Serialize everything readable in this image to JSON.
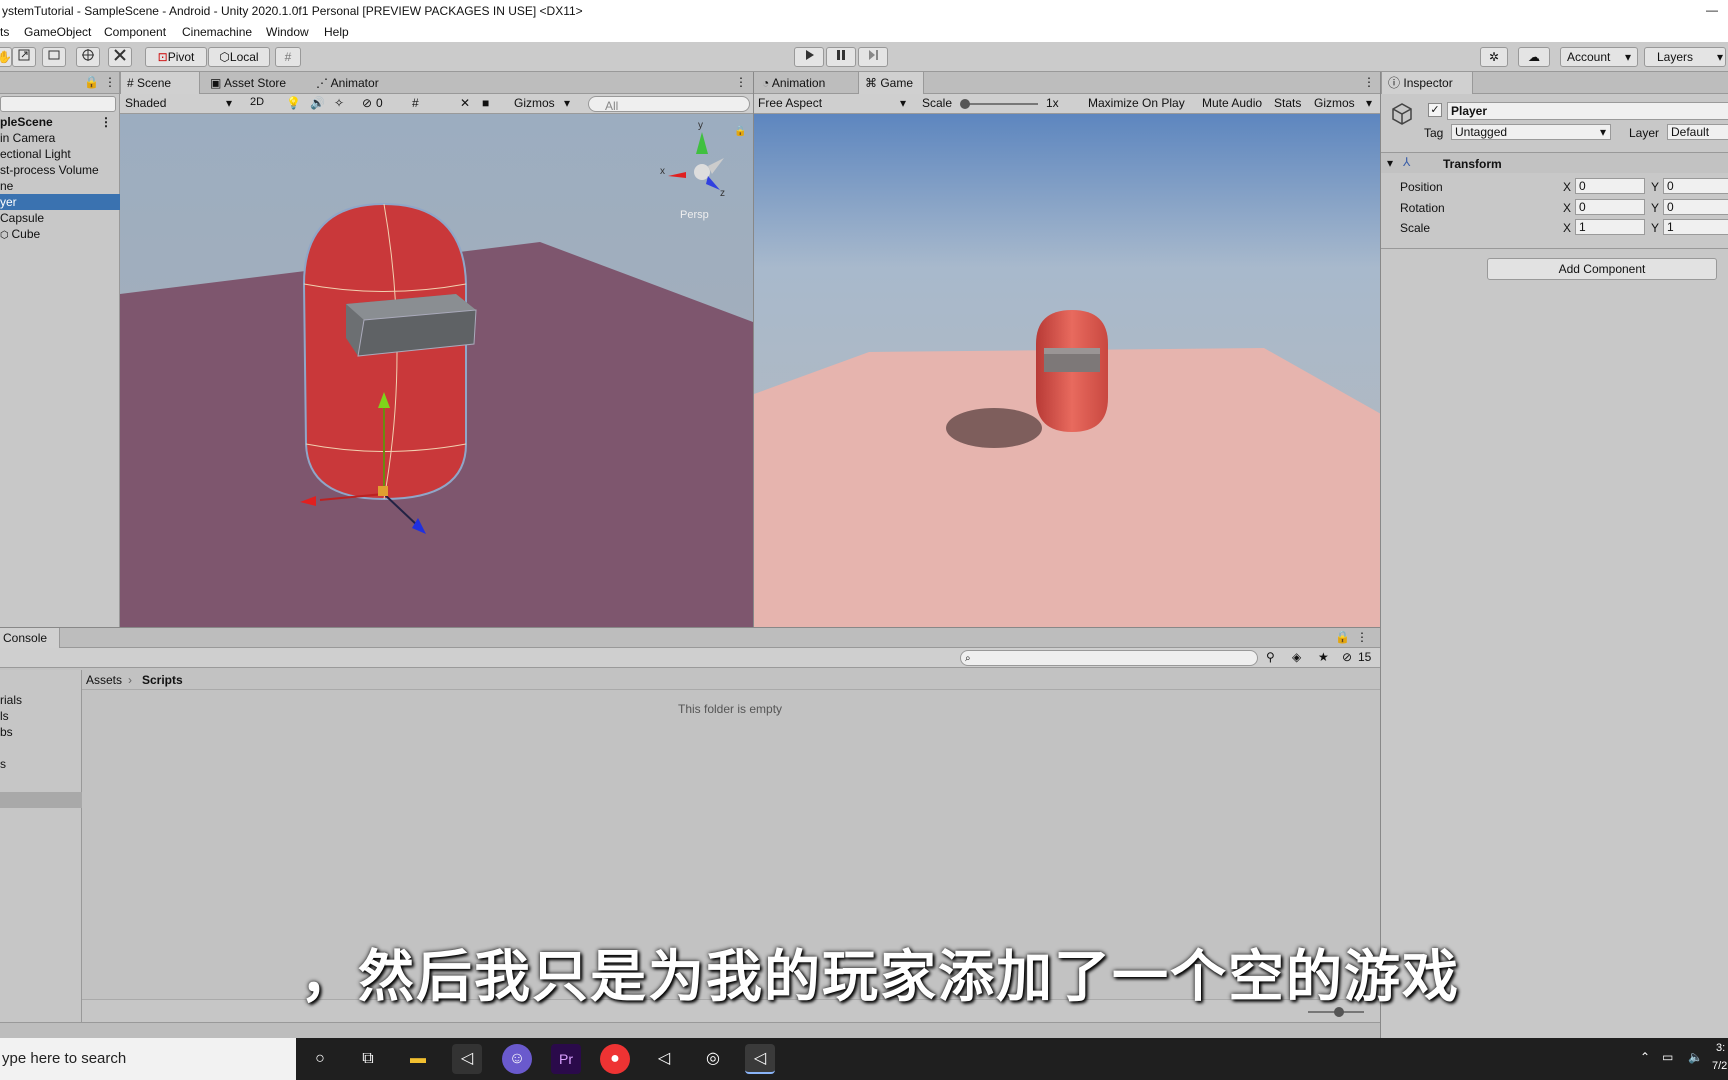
{
  "window": {
    "title": "ystemTutorial - SampleScene - Android - Unity 2020.1.0f1 Personal [PREVIEW PACKAGES IN USE] <DX11>",
    "minimize_glyph": "—"
  },
  "menu": [
    "ts",
    "GameObject",
    "Component",
    "Cinemachine",
    "Window",
    "Help"
  ],
  "toolbar": {
    "pivot_label": "Pivot",
    "local_label": "Local",
    "account_label": "Account",
    "layers_label": "Layers"
  },
  "hierarchy": {
    "items": [
      "pleScene",
      "in Camera",
      "ectional Light",
      "st-process Volume",
      "ne",
      "yer",
      "Capsule",
      "Cube"
    ],
    "selected_index": 5
  },
  "scene": {
    "tabs": [
      "Scene",
      "Asset Store",
      "Animator"
    ],
    "shading_mode": "Shaded",
    "mode_2d": "2D",
    "hidden_count": "0",
    "gizmos_label": "Gizmos",
    "search_placeholder": "All",
    "persp_label": "Persp",
    "axis_x": "x",
    "axis_y": "y",
    "axis_z": "z"
  },
  "game": {
    "tabs": [
      "Animation",
      "Game"
    ],
    "aspect": "Free Aspect",
    "scale_label": "Scale",
    "scale_value": "1x",
    "maximize_label": "Maximize On Play",
    "mute_label": "Mute Audio",
    "stats_label": "Stats",
    "gizmos_label": "Gizmos"
  },
  "inspector": {
    "tab": "Inspector",
    "object_name": "Player",
    "tag_label": "Tag",
    "tag_value": "Untagged",
    "layer_label": "Layer",
    "layer_value": "Default",
    "component_name": "Transform",
    "rows": [
      {
        "label": "Position",
        "x": "0",
        "y": "0"
      },
      {
        "label": "Rotation",
        "x": "0",
        "y": "0"
      },
      {
        "label": "Scale",
        "x": "1",
        "y": "1"
      }
    ],
    "x_axis_label": "X",
    "y_axis_label": "Y",
    "add_component_label": "Add Component"
  },
  "project": {
    "tab": "Console",
    "breadcrumb_root": "Assets",
    "breadcrumb_current": "Scripts",
    "empty_message": "This folder is empty",
    "hidden_count": "15",
    "folders": [
      "rials",
      "ls",
      "bs",
      "s"
    ]
  },
  "taskbar": {
    "search_placeholder": "ype here to search",
    "clock_time": "3:",
    "clock_date": "7/2"
  },
  "subtitle": "，然后我只是为我的玩家添加了一个空的游戏",
  "colors": {
    "accent_selection": "#3a72b0",
    "capsule_red": "#c9383a",
    "game_floor": "#e6b4ae",
    "taskbar_bg": "#1f1f1f"
  }
}
